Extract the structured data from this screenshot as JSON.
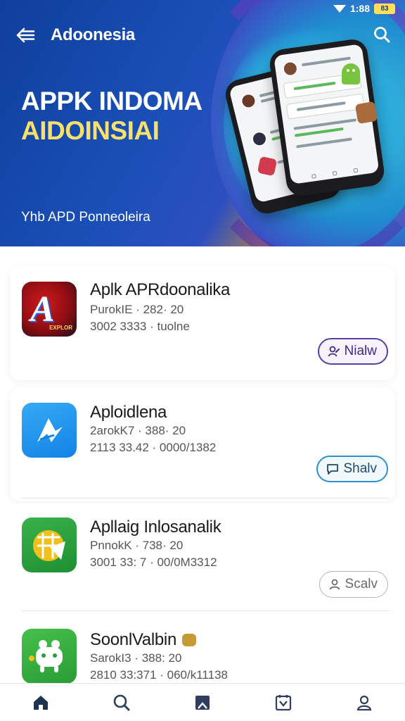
{
  "status_bar": {
    "time": "1:88",
    "battery": "83"
  },
  "header": {
    "title": "Adoonesia",
    "back_icon": "arrow-left-icon",
    "search_icon": "search-icon"
  },
  "hero": {
    "line1": "APPK INDOMA",
    "line2": "AIDOINSIAI",
    "subtitle": "Yhb APD Ponneoleira"
  },
  "apps": [
    {
      "name": "Aplk APRdoonalika",
      "meta1": "PurokIE · 282· 20",
      "meta2": "3002 3333 ·  tuolne",
      "button": "Nialw",
      "icon": "red-a-logo-icon",
      "accent": "#5b3ea8"
    },
    {
      "name": "Aploidlena",
      "meta1": "2arokK7 · 388· 20",
      "meta2": "2113 33.42 · 0000/1382",
      "button": "Shalv",
      "icon": "blue-pen-logo-icon",
      "accent": "#2f8fcf"
    },
    {
      "name": "Apllaig Inlosanalik",
      "meta1": "PnnokK · 738· 20",
      "meta2": "3001 33: 7 · 00/0M3312",
      "button": "Scalv",
      "icon": "green-map-logo-icon",
      "accent": "#9a9a9a"
    },
    {
      "name": "SoonlValbin",
      "meta1": "SarokI3 · 388: 20",
      "meta2": "2810 33:371 · 060/k11138",
      "icon": "green-bear-logo-icon"
    }
  ],
  "bottom_nav": [
    {
      "icon": "home-icon",
      "label": "Home"
    },
    {
      "icon": "search-icon",
      "label": "Search"
    },
    {
      "icon": "bookmark-icon",
      "label": "Saved"
    },
    {
      "icon": "calendar-icon",
      "label": "Updates"
    },
    {
      "icon": "profile-icon",
      "label": "Profile"
    }
  ],
  "colors": {
    "hero_blue": "#1a4fb6",
    "hero_orange": "#f39a1c",
    "hero_yellow_text": "#f8e06a"
  }
}
